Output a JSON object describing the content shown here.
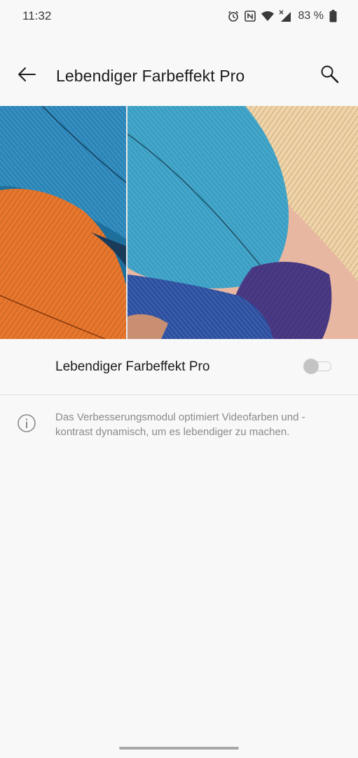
{
  "status_bar": {
    "time": "11:32",
    "battery": "83 %",
    "icons": [
      "alarm-icon",
      "nfc-icon",
      "wifi-icon",
      "signal-icon",
      "battery-icon"
    ]
  },
  "app_bar": {
    "title": "Lebendiger Farbeffekt Pro",
    "back_icon": "back-arrow-icon",
    "search_icon": "search-icon"
  },
  "setting": {
    "label": "Lebendiger Farbeffekt Pro",
    "enabled": false
  },
  "info": {
    "icon": "info-icon",
    "text": "Das Verbesserungsmodul optimiert Videofarben und -kontrast dynamisch, um es lebendiger zu machen."
  },
  "colors": {
    "background": "#f8f8f8",
    "text_primary": "#1c1c1c",
    "text_secondary": "#8a8a8a",
    "toggle_off": "#c4c4c4"
  }
}
